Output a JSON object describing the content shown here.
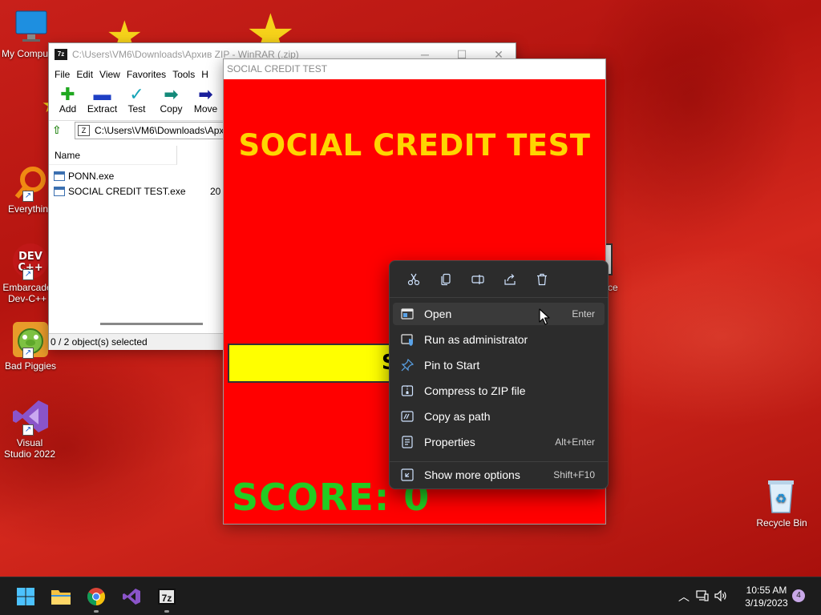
{
  "desktop": {
    "icons": [
      {
        "label": "My Compu"
      },
      {
        "label": "Everythin"
      },
      {
        "label": "Embarcade Dev-C++"
      },
      {
        "label": "Bad Piggies"
      },
      {
        "label": "Visual Studio 2022"
      },
      {
        "label": "Recycle Bin"
      }
    ],
    "partial_icon_label": "ce"
  },
  "winrar": {
    "title": "C:\\Users\\VM6\\Downloads\\Архив ZIP - WinRAR (.zip)",
    "app_icon_text": "7z",
    "menu": [
      "File",
      "Edit",
      "View",
      "Favorites",
      "Tools",
      "H"
    ],
    "toolbar": [
      {
        "label": "Add",
        "icon": "add-icon"
      },
      {
        "label": "Extract",
        "icon": "extract-icon"
      },
      {
        "label": "Test",
        "icon": "test-icon"
      },
      {
        "label": "Copy",
        "icon": "copy-icon"
      },
      {
        "label": "Move",
        "icon": "move-icon"
      }
    ],
    "address": "C:\\Users\\VM6\\Downloads\\Apx",
    "address_icon_text": "Z",
    "column_name": "Name",
    "files": [
      {
        "name": "PONN.exe",
        "size": ""
      },
      {
        "name": "SOCIAL CREDIT TEST.exe",
        "size": "20"
      }
    ],
    "status": "0 / 2 object(s) selected"
  },
  "social_credit": {
    "title": "SOCIAL CREDIT TEST",
    "heading": "SOCIAL CREDIT TEST",
    "button_label": "S",
    "score_text": "SCORE: 0"
  },
  "context_menu": {
    "quick_actions": [
      "cut-icon",
      "copy-icon",
      "rename-icon",
      "share-icon",
      "delete-icon"
    ],
    "items": [
      {
        "label": "Open",
        "shortcut": "Enter",
        "icon": "open-icon"
      },
      {
        "label": "Run as administrator",
        "shortcut": "",
        "icon": "shield-icon"
      },
      {
        "label": "Pin to Start",
        "shortcut": "",
        "icon": "pin-icon"
      },
      {
        "label": "Compress to ZIP file",
        "shortcut": "",
        "icon": "zip-icon"
      },
      {
        "label": "Copy as path",
        "shortcut": "",
        "icon": "path-icon"
      },
      {
        "label": "Properties",
        "shortcut": "Alt+Enter",
        "icon": "properties-icon"
      },
      {
        "label": "Show more options",
        "shortcut": "Shift+F10",
        "icon": "more-options-icon"
      }
    ]
  },
  "taskbar": {
    "apps": [
      "start-icon",
      "file-explorer-icon",
      "chrome-icon",
      "visual-studio-icon",
      "7zip-icon"
    ],
    "seven_zip_text": "7z",
    "time": "10:55 AM",
    "date": "3/19/2023",
    "notification_count": "4"
  },
  "colors": {
    "sc_background": "#ff0000",
    "sc_heading": "#ffd500",
    "sc_button": "#ffff00",
    "sc_score": "#22cc22",
    "menu_background": "#2c2c2c"
  }
}
